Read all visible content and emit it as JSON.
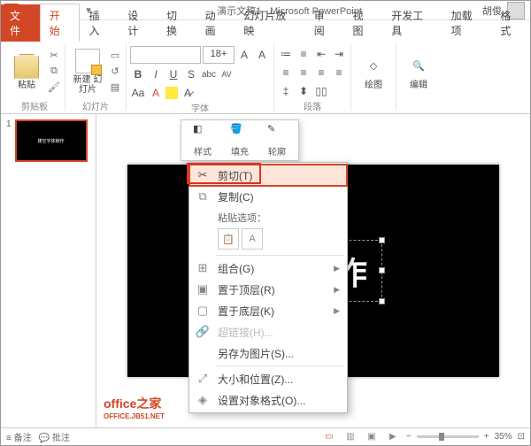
{
  "titlebar": {
    "title": "演示文稿1 - Microsoft PowerPoint",
    "user": "胡俊"
  },
  "tabs": {
    "file": "文件",
    "home": "开始",
    "insert": "插入",
    "design": "设计",
    "transitions": "切换",
    "animations": "动画",
    "slideshow": "幻灯片放映",
    "review": "审阅",
    "view": "视图",
    "developer": "开发工具",
    "addins": "加载项",
    "format": "格式"
  },
  "ribbon": {
    "clipboard": {
      "label": "剪贴板",
      "paste": "粘贴"
    },
    "slides": {
      "label": "幻灯片",
      "new": "新建\n幻灯片"
    },
    "font": {
      "label": "字体",
      "size": "18+",
      "bold": "B",
      "italic": "I",
      "underline": "U",
      "strike": "S",
      "shadow": "abc",
      "spacing": "AV",
      "case": "Aa",
      "clear": "A"
    },
    "paragraph": {
      "label": "段落"
    },
    "drawing": {
      "label": "绘图"
    },
    "editing": {
      "label": "编辑"
    }
  },
  "floating": {
    "style": "样式",
    "fill": "填充",
    "outline": "轮廓"
  },
  "thumb": {
    "num": "1",
    "text": "镂空字体制作"
  },
  "slide": {
    "text": "镂    制作"
  },
  "watermark": {
    "main": "office之家",
    "sub": "OFFICE.JB51.NET"
  },
  "context": {
    "cut": "剪切(T)",
    "copy": "复制(C)",
    "paste_label": "粘贴选项：",
    "group": "组合(G)",
    "front": "置于顶层(R)",
    "back": "置于底层(K)",
    "hyperlink": "超链接(H)...",
    "savepic": "另存为图片(S)...",
    "size": "大小和位置(Z)...",
    "format": "设置对象格式(O)..."
  },
  "status": {
    "notes": "备注",
    "comments": "批注",
    "zoom": "35%"
  }
}
